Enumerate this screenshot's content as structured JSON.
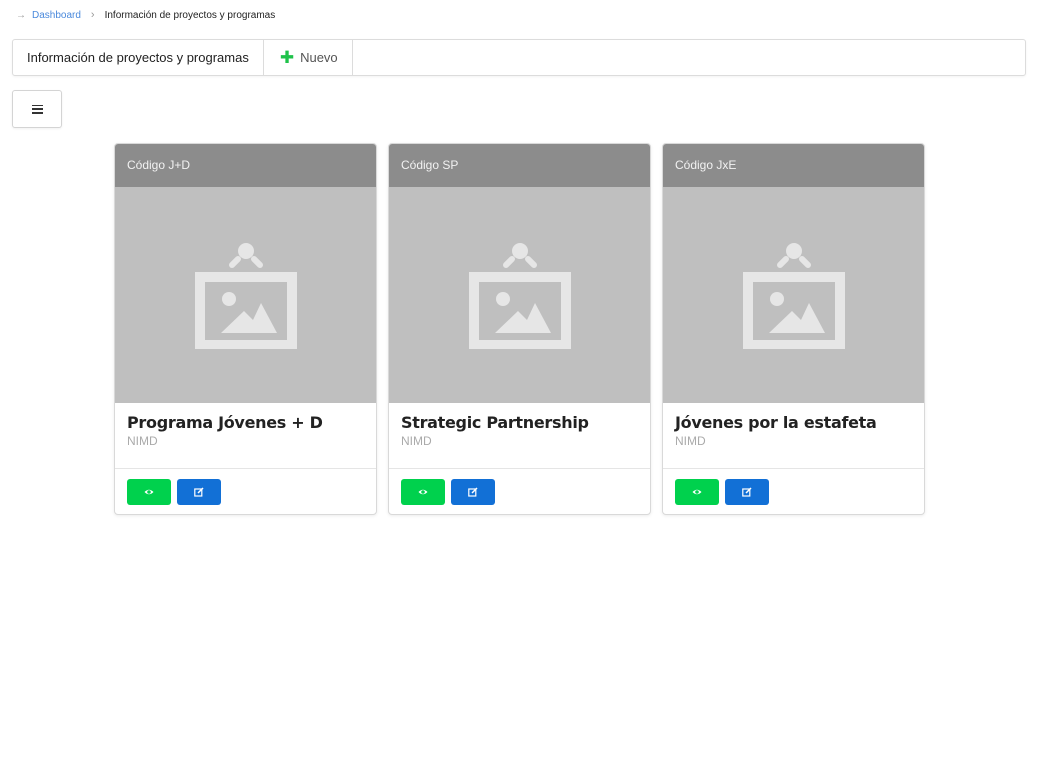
{
  "breadcrumb": {
    "items": [
      {
        "label": "Dashboard"
      },
      {
        "label": "Información de proyectos y programas"
      }
    ]
  },
  "toolbar": {
    "title": "Información de proyectos y programas",
    "new_label": "Nuevo",
    "new_icon": "plus-icon"
  },
  "menu_toggle": {
    "icon": "hamburger-menu-icon"
  },
  "cards": [
    {
      "code": "Código J+D",
      "title": "Programa Jóvenes + D",
      "organization": "NIMD",
      "image_icon": "image-placeholder-icon"
    },
    {
      "code": "Código SP",
      "title": "Strategic Partnership",
      "organization": "NIMD",
      "image_icon": "image-placeholder-icon"
    },
    {
      "code": "Código JxE",
      "title": "Jóvenes por la estafeta",
      "organization": "NIMD",
      "image_icon": "image-placeholder-icon"
    }
  ],
  "card_actions": {
    "view_icon": "eye-icon",
    "edit_icon": "edit-icon"
  },
  "colors": {
    "accent_link": "#4a89dc",
    "view_button": "#00d14d",
    "edit_button": "#1270d6",
    "plus_icon": "#1fc24a",
    "card_header": "#8c8c8c",
    "image_placeholder": "#bfbfbf"
  }
}
